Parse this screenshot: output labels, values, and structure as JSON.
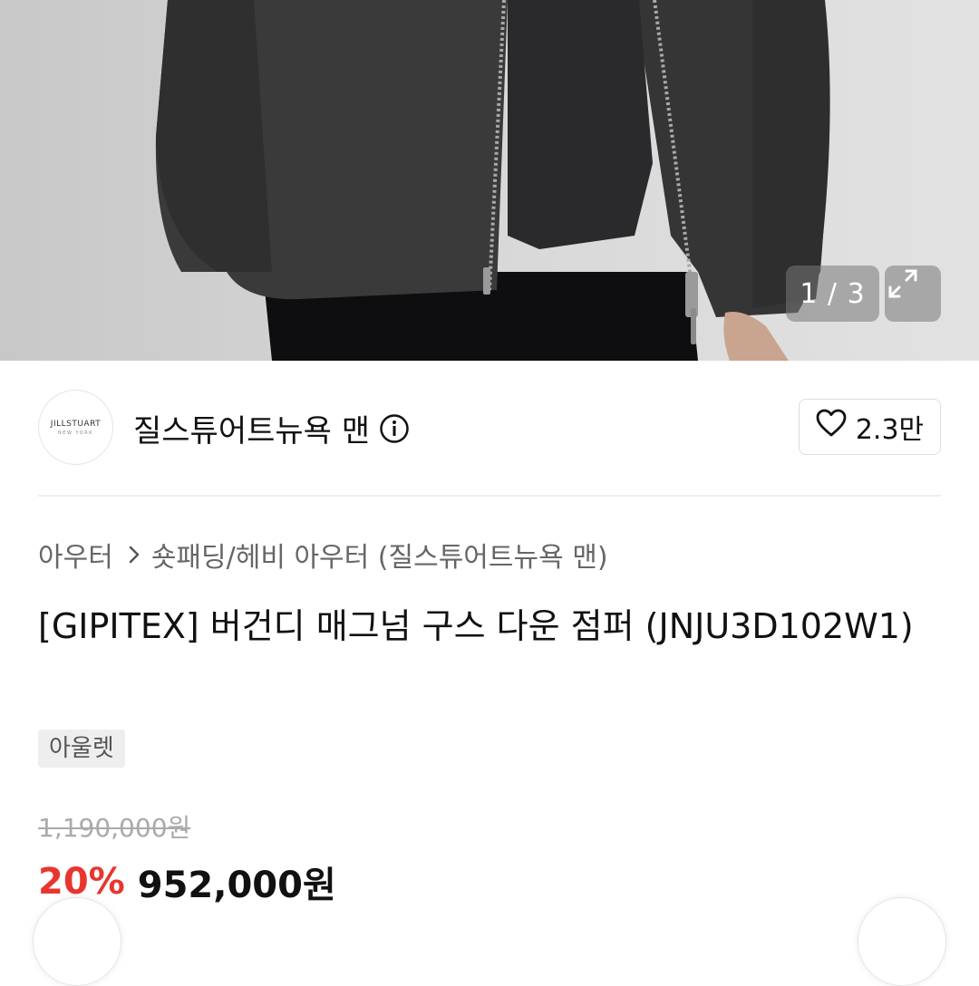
{
  "gallery": {
    "counter": "1 / 3",
    "expand_icon": "expand-arrows-icon"
  },
  "brand": {
    "logo_text": "JILLSTUART",
    "logo_subtext": "NEW YORK",
    "name": "질스튜어트뉴욕 맨",
    "info_icon": "info-circle-icon",
    "likes": "2.3만",
    "like_icon": "heart-outline-icon"
  },
  "breadcrumb": {
    "items": [
      "아우터",
      "숏패딩/헤비 아우터 (질스튜어트뉴욕 맨)"
    ]
  },
  "product": {
    "title": "[GIPITEX] 버건디 매그넘 구스 다운 점퍼 (JNJU3D102W1)",
    "badge": "아울렛"
  },
  "price": {
    "original": "1,190,000원",
    "discount": "20%",
    "sale": "952,000원"
  },
  "colors": {
    "discount": "#e8362e",
    "text": "#111111",
    "muted": "#666666"
  }
}
